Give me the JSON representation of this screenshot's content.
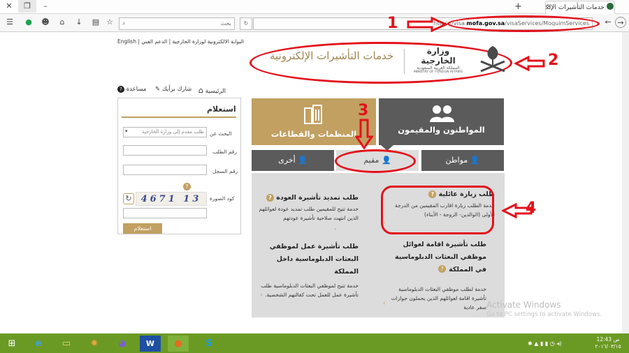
{
  "browser": {
    "tab_title": "خدمات التأشيرات الإلكترونية",
    "new_tab": "+",
    "url_prefix": "https://visa.",
    "url_domain": "mofa.gov.sa",
    "url_path": "/visaServices/MoquimServices",
    "search_placeholder": "بحث"
  },
  "header": {
    "top_links": "البوابة الالكترونية لوزارة الخارجية | الدعم الفني | English",
    "site_title": "خدمات التأشيرات الإلكترونية",
    "ministry_ar": "وزارة الخارجية",
    "ministry_kingdom": "المملكة العربية السعودية",
    "ministry_en": "MINISTRY OF FOREIGN AFFAIRS"
  },
  "nav": {
    "home": "الرئيسية",
    "share": "شارك برأيك",
    "help": "مساعدة"
  },
  "inquiry": {
    "title": "استعلام",
    "search_by_label": "البحث عن",
    "search_by_value": "طلب مقدم إلى وزارة الخارجية",
    "request_no_label": "رقم الطلب",
    "registry_no_label": "رقم السجل",
    "captcha_label": "كود الصورة",
    "captcha_text": "4671 13",
    "submit": "استعلام"
  },
  "categories": {
    "citizens_residents": "المواطنون والمقيمون",
    "organizations": "المنظمات والقطاعات",
    "tab_citizen": "مواطن",
    "tab_resident": "مقيم",
    "tab_other": "أخرى"
  },
  "services": [
    {
      "title": "طلب زيارة عائلية",
      "desc": "خدمة الطلب زيارة اقارب المقيمين من الدرجة الأولى (الوالدين- الزوجة - الأبناء)"
    },
    {
      "title": "طلب تمديد تأشيرة العودة",
      "desc": "خدمة تتيح للمقيمين طلب تمديد عودة لعوائلهم الذين انتهت صلاحية تأشيرة عودتهم"
    },
    {
      "title": "طلب تأشيرة اقامة لعوائل موظفي البعثات الدبلوماسية في المملكة",
      "desc": "خدمة لطلب موظفي البعثات الدبلوماسية تأشيرة اقامة لعوائلهم الذين يحملون جوازات سفر عادية"
    },
    {
      "title": "طلب تأشيرة عمل لموظفي البعثات الدبلوماسية داخل المملكة",
      "desc": "خدمة تتيح لموظفي البعثات الدبلوماسية طلب تأشيرة عمل للعمل تحت كفالتهم الشخصية."
    }
  ],
  "annotations": [
    "1",
    "2",
    "3",
    "4"
  ],
  "watermark": {
    "line1": "Activate Windows",
    "line2": "Go to PC settings to activate Windows."
  },
  "taskbar": {
    "time": "12:43 ص",
    "date": "٢٠١٦/٠٣/١٥"
  },
  "colors": {
    "gold": "#c1a061",
    "panel_gray": "#5b5b5b",
    "annotation_red": "#e4111b",
    "taskbar_green": "#6b9a24"
  }
}
